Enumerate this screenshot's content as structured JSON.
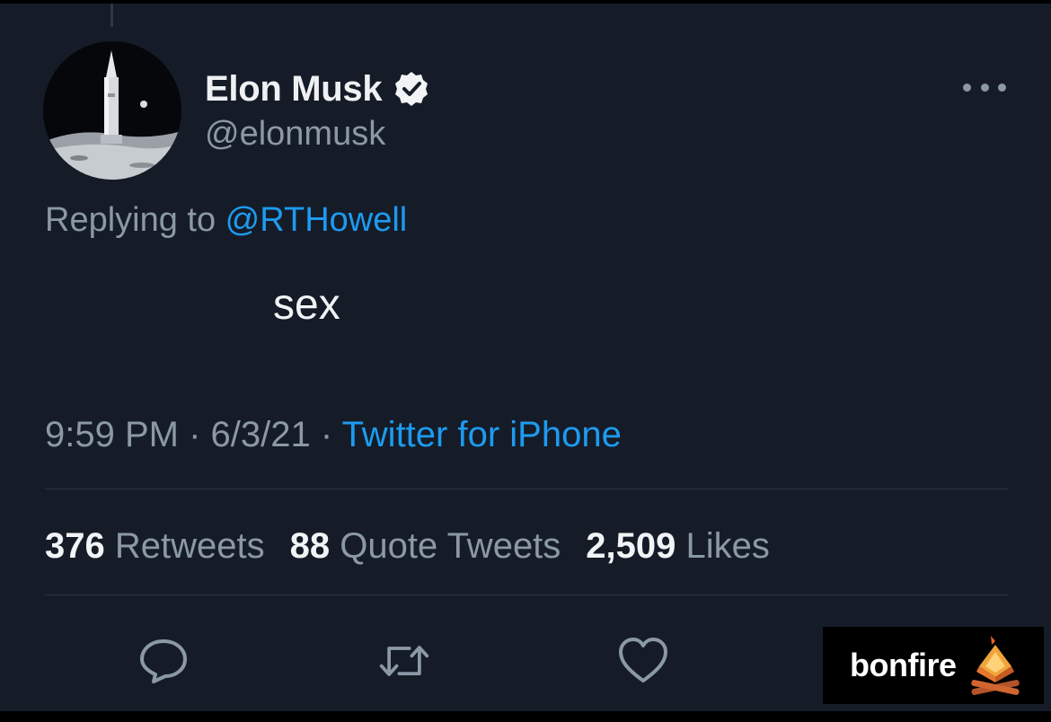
{
  "tweet": {
    "author": {
      "display_name": "Elon Musk",
      "handle": "@elonmusk",
      "verified": true
    },
    "replying": {
      "prefix": "Replying to ",
      "mention": "@RTHowell"
    },
    "text": "sex",
    "meta": {
      "time": "9:59 PM",
      "separator": " · ",
      "date": "6/3/21",
      "source": "Twitter for iPhone"
    },
    "stats": {
      "retweets_count": "376",
      "retweets_label": " Retweets",
      "quotes_count": "88",
      "quotes_label": " Quote Tweets",
      "likes_count": "2,509",
      "likes_label": " Likes"
    },
    "actions": [
      "reply-icon",
      "retweet-icon",
      "like-icon"
    ]
  },
  "watermark": {
    "text": "bonfire",
    "icon": "bonfire-logo-icon"
  },
  "colors": {
    "background": "#151c28",
    "accent": "#1d9bf0",
    "secondary_text": "#8b98a5",
    "primary_text": "#f1f3f5"
  }
}
